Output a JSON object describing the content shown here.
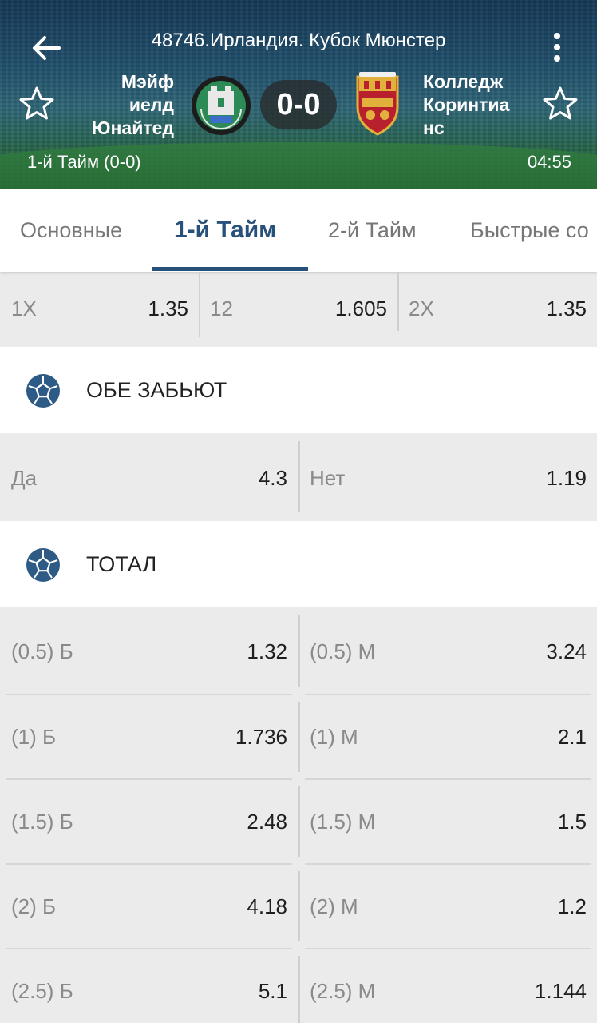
{
  "header": {
    "title": "48746.Ирландия. Кубок Мюнстер",
    "home_team": "Мэйф иелд Юнайтед",
    "away_team": "Колледж Коринтиа нс",
    "score": "0-0",
    "period": "1-й  Тайм (0-0)",
    "clock": "04:55"
  },
  "tabs": [
    {
      "label": "Основные"
    },
    {
      "label": "1-й  Тайм"
    },
    {
      "label": "2-й  Тайм"
    },
    {
      "label": "Быстрые со"
    }
  ],
  "double_chance": [
    {
      "label": "1X",
      "odd": "1.35"
    },
    {
      "label": "12",
      "odd": "1.605"
    },
    {
      "label": "2X",
      "odd": "1.35"
    }
  ],
  "both_score": {
    "title": "ОБЕ ЗАБЬЮТ",
    "options": [
      {
        "label": "Да",
        "odd": "4.3"
      },
      {
        "label": "Нет",
        "odd": "1.19"
      }
    ]
  },
  "total": {
    "title": "ТОТАЛ",
    "rows": [
      {
        "over_label": "(0.5) Б",
        "over_odd": "1.32",
        "under_label": "(0.5) М",
        "under_odd": "3.24"
      },
      {
        "over_label": "(1) Б",
        "over_odd": "1.736",
        "under_label": "(1) М",
        "under_odd": "2.1"
      },
      {
        "over_label": "(1.5) Б",
        "over_odd": "2.48",
        "under_label": "(1.5) М",
        "under_odd": "1.5"
      },
      {
        "over_label": "(2) Б",
        "over_odd": "4.18",
        "under_label": "(2) М",
        "under_odd": "1.2"
      },
      {
        "over_label": "(2.5) Б",
        "over_odd": "5.1",
        "under_label": "(2.5) М",
        "under_odd": "1.144"
      }
    ]
  },
  "icons": {
    "back": "arrow-left-icon",
    "more": "more-vertical-icon",
    "favorite": "star-outline-icon",
    "section": "football-icon"
  },
  "colors": {
    "accent": "#27517a",
    "ball": "#2e5b86"
  }
}
